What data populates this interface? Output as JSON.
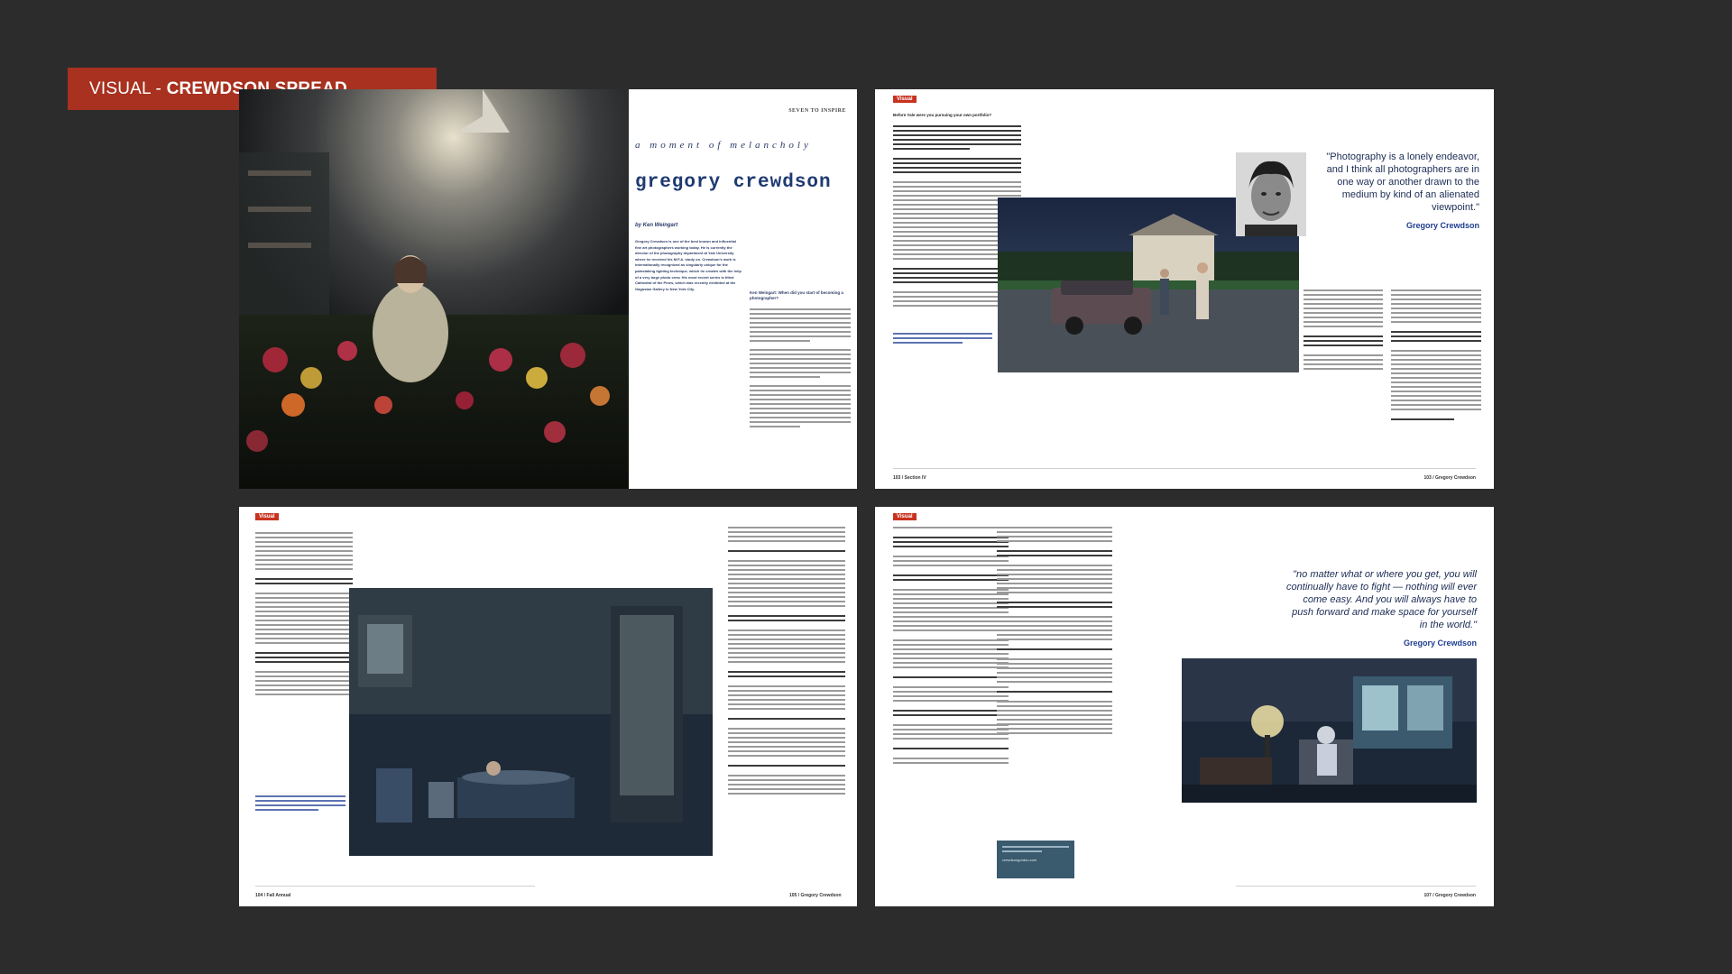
{
  "banner": {
    "prefix": "VISUAL - ",
    "title": "CREWDSON SPREAD"
  },
  "spread1": {
    "kicker": "SEVEN TO INSPIRE",
    "tagline": "a moment of melancholy",
    "headline": "gregory crewdson",
    "byline": "by Ken Weingart",
    "intro": "Gregory Crewdson is one of the best known and influential fine art photographers working today. He is currently the director of the photography department at Yale University where he received his M.F.A. study on. Crewdson's work is internationally recognized as singularly unique for the painstaking lighting technique, which he creates with the help of a very large photo crew. His most recent series is titled Cathedral of the Pines, which was recently exhibited at the Gagosian Gallery in New York City.",
    "q1": "Ken Weingart: When did you start of becoming a photographer?"
  },
  "spread2": {
    "tag": "Visual",
    "q1": "Before Yale were you pursuing your own portfolio?",
    "quote": "\"Photography is a lonely endeavor, and I think all photographers are in one way or another drawn to the medium by kind of an alienated viewpoint.\"",
    "quote_name": "Gregory Crewdson",
    "footer_left": "103 / Section IV",
    "footer_right": "103 / Gregory Crewdson"
  },
  "spread3": {
    "tag": "Visual",
    "footer_left": "104 / Fall Annual",
    "footer_right": "105 / Gregory Crewdson"
  },
  "spread4": {
    "tag": "Visual",
    "quote": "\"no matter what or where you get, you will continually have to fight — nothing will ever come easy. And you will always have to push forward and make space for yourself in the world.\"",
    "quote_name": "Gregory Crewdson",
    "box_url": "crewdsongordon.com",
    "footer_right": "107 / Gregory Crewdson"
  }
}
